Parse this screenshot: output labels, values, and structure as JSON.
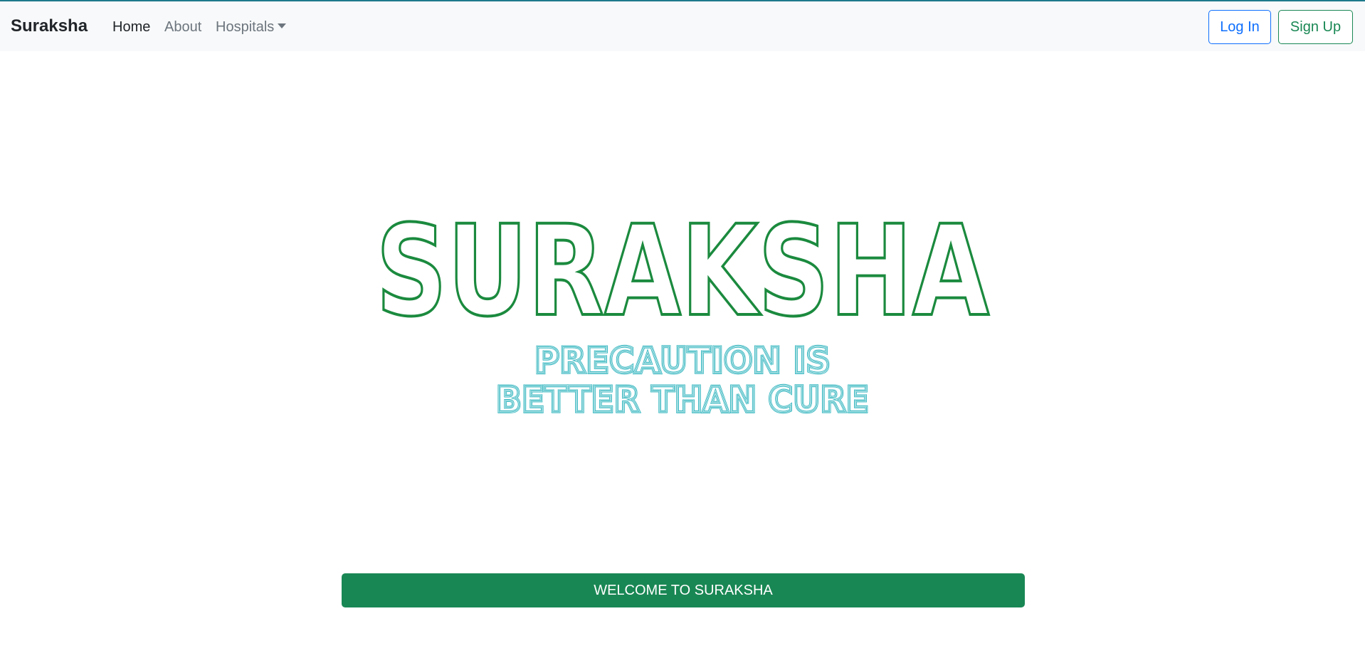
{
  "navbar": {
    "brand": "Suraksha",
    "links": [
      {
        "label": "Home",
        "active": true
      },
      {
        "label": "About",
        "active": false
      },
      {
        "label": "Hospitals",
        "active": false,
        "dropdown": true
      }
    ],
    "login_label": "Log In",
    "signup_label": "Sign Up"
  },
  "hero": {
    "logo_text": "SURAKSHA",
    "tagline_line1": "PRECAUTION IS",
    "tagline_line2": "BETTER THAN CURE",
    "welcome_label": "WELCOME TO SURAKSHA"
  },
  "colors": {
    "logo_stroke": "#1b8a3e",
    "tagline": "#3ab8c1",
    "primary_blue": "#0d6efd",
    "success_green": "#198754",
    "navbar_bg": "#f8f9fa"
  }
}
